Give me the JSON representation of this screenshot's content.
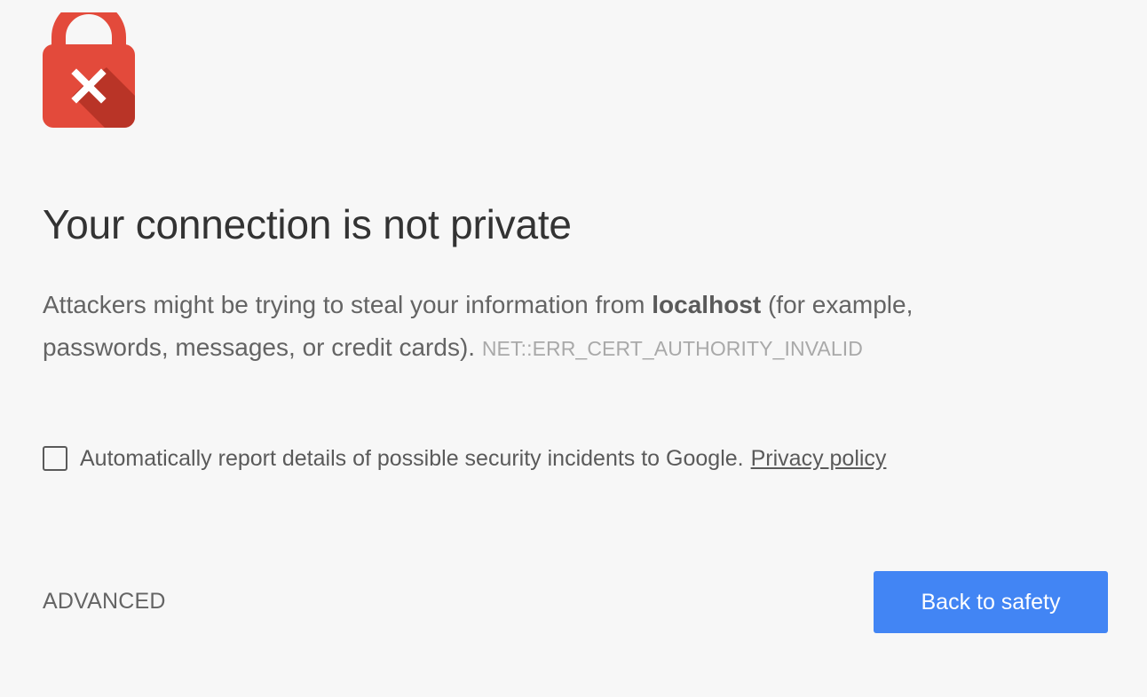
{
  "interstitial": {
    "icon": "lock-error-icon",
    "colors": {
      "lock_body": "#e34a3b",
      "lock_shadow": "#b23025",
      "button_primary": "#4285f4",
      "background": "#f7f7f7"
    },
    "title": "Your connection is not private",
    "explanation": {
      "prefix": "Attackers might be trying to steal your information from ",
      "host": "localhost",
      "suffix": " (for example, passwords, messages, or credit cards).",
      "error_code": "NET::ERR_CERT_AUTHORITY_INVALID"
    },
    "report": {
      "checked": false,
      "label": "Automatically report details of possible security incidents to Google.",
      "privacy_link": "Privacy policy"
    },
    "advanced_label": "ADVANCED",
    "primary_button_label": "Back to safety"
  }
}
